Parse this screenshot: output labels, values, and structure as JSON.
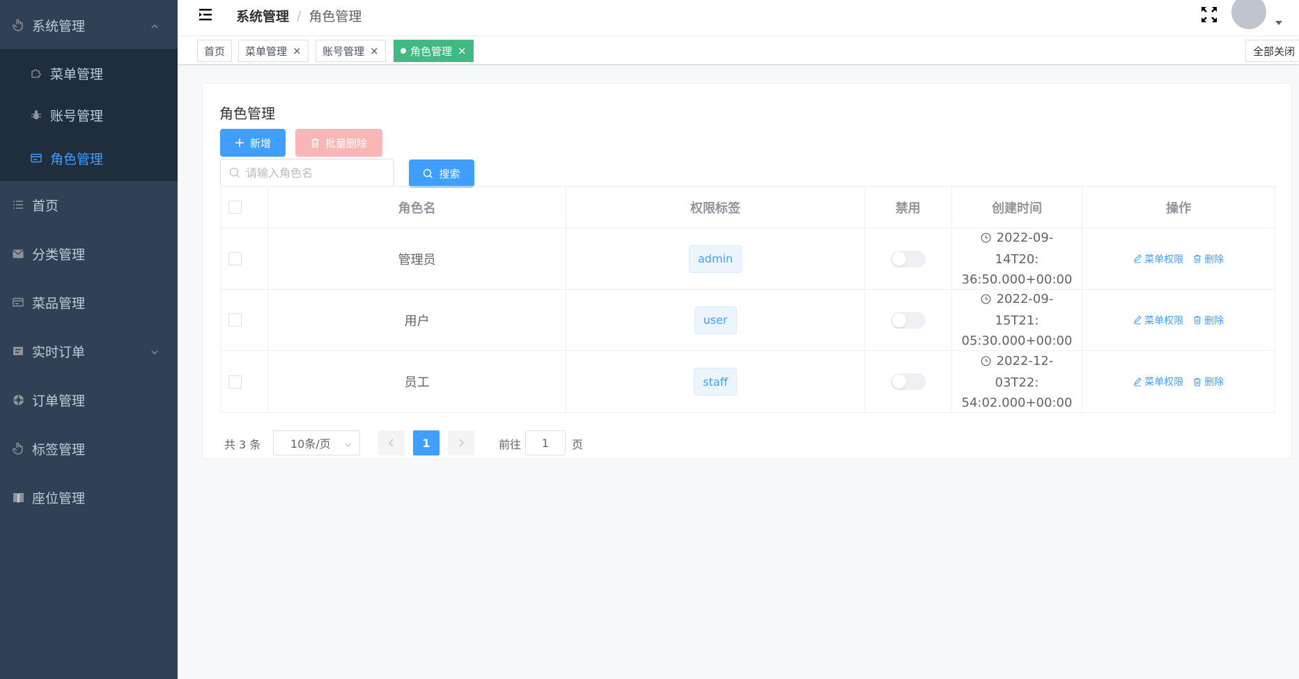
{
  "sidebar": {
    "items": [
      {
        "label": "系统管理",
        "icon": "hand-icon",
        "expanded": true
      },
      {
        "label": "菜单管理",
        "icon": "puzzle-icon"
      },
      {
        "label": "账号管理",
        "icon": "bug-icon"
      },
      {
        "label": "角色管理",
        "icon": "card-icon",
        "active": true
      },
      {
        "label": "首页",
        "icon": "list-icon"
      },
      {
        "label": "分类管理",
        "icon": "mail-icon"
      },
      {
        "label": "菜品管理",
        "icon": "card-icon"
      },
      {
        "label": "实时订单",
        "icon": "ticket-icon",
        "expandable": true
      },
      {
        "label": "订单管理",
        "icon": "help-icon"
      },
      {
        "label": "标签管理",
        "icon": "hand-icon"
      },
      {
        "label": "座位管理",
        "icon": "book-icon"
      }
    ]
  },
  "header": {
    "breadcrumb": [
      "系统管理",
      "角色管理"
    ],
    "separator": "/"
  },
  "tags": {
    "items": [
      {
        "label": "首页",
        "closable": false
      },
      {
        "label": "菜单管理",
        "closable": true
      },
      {
        "label": "账号管理",
        "closable": true
      },
      {
        "label": "角色管理",
        "closable": true,
        "active": true
      }
    ],
    "close_icon": "×",
    "close_all": "全部关闭"
  },
  "main": {
    "title": "角色管理",
    "add_label": "新增",
    "batch_delete_label": "批量删除",
    "search_placeholder": "请输入角色名",
    "search_label": "搜索"
  },
  "table": {
    "columns": [
      "角色名",
      "权限标签",
      "禁用",
      "创建时间",
      "操作"
    ],
    "rows": [
      {
        "name": "管理员",
        "perm": "admin",
        "disabled": false,
        "time_line1": "2022-09-14T20:",
        "time_line2": "36:50.000+00:00"
      },
      {
        "name": "用户",
        "perm": "user",
        "disabled": false,
        "time_line1": "2022-09-15T21:",
        "time_line2": "05:30.000+00:00"
      },
      {
        "name": "员工",
        "perm": "staff",
        "disabled": false,
        "time_line1": "2022-12-03T22:",
        "time_line2": "54:02.000+00:00"
      }
    ],
    "op_menu_perm": "菜单权限",
    "op_delete": "删除"
  },
  "pagination": {
    "total_text": "共 3 条",
    "page_size": "10条/页",
    "current_page": "1",
    "goto_label": "前往",
    "goto_value": "1",
    "page_suffix": "页"
  },
  "colors": {
    "sidebar_bg": "#304156",
    "active_menu": "#409eff",
    "primary": "#409eff",
    "active_tag": "#42b983",
    "danger_disabled": "#fab6b6"
  }
}
